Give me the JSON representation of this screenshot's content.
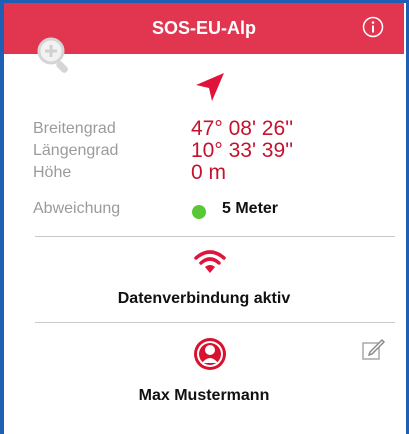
{
  "header": {
    "title": "SOS-EU-Alp",
    "accent": "#e23650"
  },
  "icons": {
    "zoom": "zoom-in-icon",
    "info": "info-icon",
    "direction": "navigation-arrow-icon",
    "connection": "wifi-icon",
    "user": "user-avatar-icon",
    "edit": "edit-icon"
  },
  "position": {
    "latitude_label": "Breitengrad",
    "latitude_value": "47° 08' 26''",
    "longitude_label": "Längengrad",
    "longitude_value": "10° 33' 39''",
    "altitude_label": "Höhe",
    "altitude_value": "0 m",
    "deviation_label": "Abweichung",
    "deviation_value": "5 Meter",
    "deviation_status_color": "#58c837",
    "value_color": "#c5122f"
  },
  "connection": {
    "status_text": "Datenverbindung aktiv"
  },
  "user": {
    "name": "Max Mustermann"
  }
}
